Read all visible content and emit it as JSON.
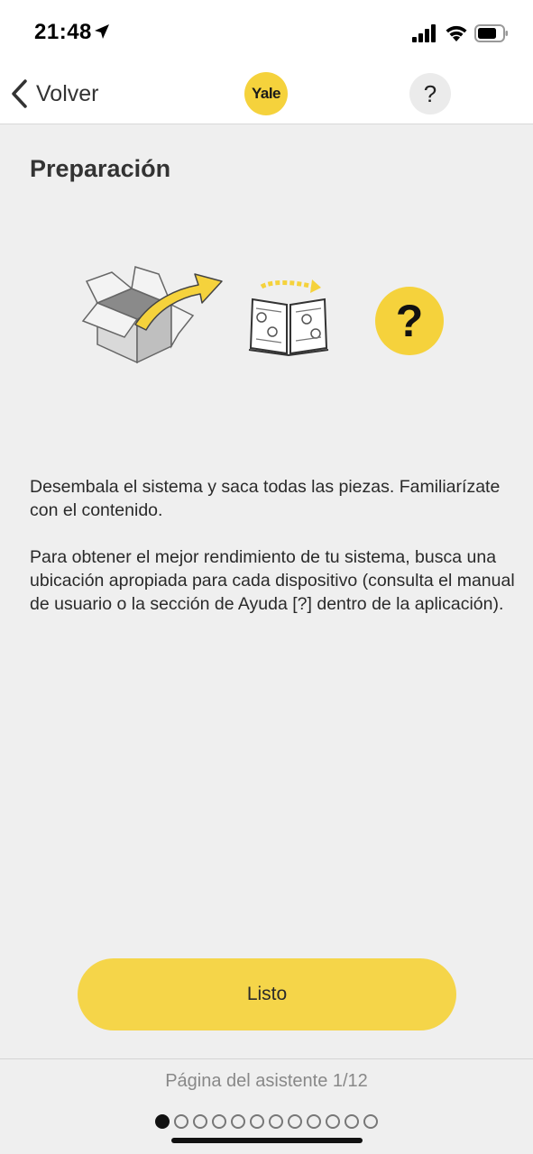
{
  "status_bar": {
    "time": "21:48"
  },
  "nav": {
    "back_label": "Volver",
    "logo_text": "Yale",
    "help_label": "?"
  },
  "page": {
    "title": "Preparación"
  },
  "illustration": {
    "question_mark": "?"
  },
  "body": {
    "paragraph_1": "Desembala el sistema y saca todas las piezas. Familiarízate con el contenido.",
    "paragraph_2": "Para obtener el mejor rendimiento de tu sistema, busca una ubicación apropiada para cada dispositivo (consulta el manual de usuario o la sección de Ayuda [?] dentro de la aplicación)."
  },
  "actions": {
    "done_label": "Listo"
  },
  "footer": {
    "page_indicator": "Página del asistente 1/12",
    "current_page": 1,
    "total_pages": 12
  },
  "colors": {
    "accent": "#f5d549",
    "background": "#efefef"
  }
}
